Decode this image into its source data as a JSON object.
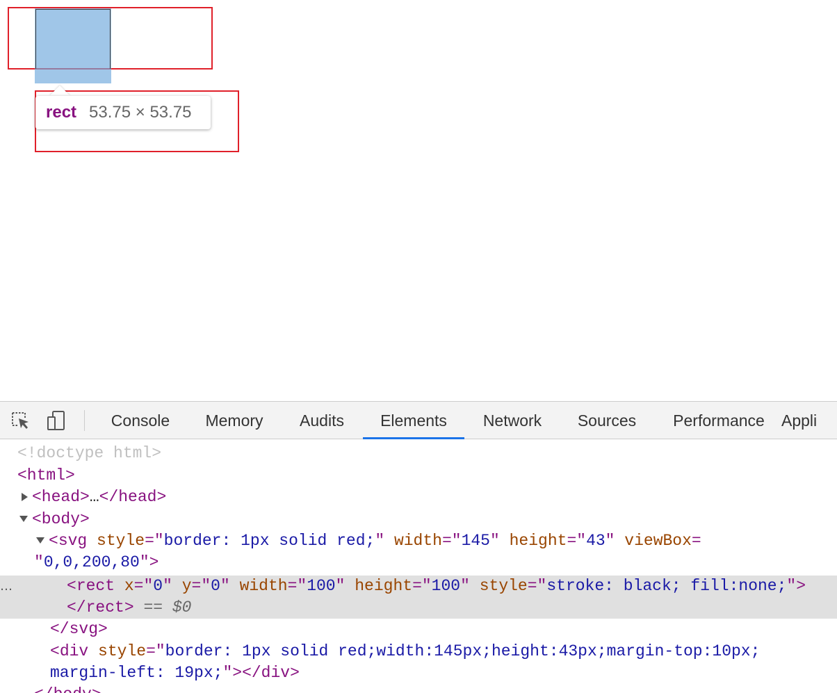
{
  "viewport": {
    "tooltip": {
      "tag": "rect",
      "size": "53.75 × 53.75"
    }
  },
  "devtools": {
    "tabs": [
      {
        "label": "Console",
        "active": false
      },
      {
        "label": "Memory",
        "active": false
      },
      {
        "label": "Audits",
        "active": false
      },
      {
        "label": "Elements",
        "active": true
      },
      {
        "label": "Network",
        "active": false
      },
      {
        "label": "Sources",
        "active": false
      },
      {
        "label": "Performance",
        "active": false
      },
      {
        "label": "Appli",
        "active": false
      }
    ],
    "icons": {
      "inspect": "inspect-element-icon",
      "device": "device-toolbar-icon"
    },
    "dom": {
      "doctype": "<!doctype html>",
      "html_open": "<html>",
      "head_open": "<head>",
      "head_ellipsis": "…",
      "head_close": "</head>",
      "body_open": "<body>",
      "svg_tag": "svg",
      "svg_attr_style": "style",
      "svg_val_style": "border: 1px solid red;",
      "svg_attr_width": "width",
      "svg_val_width": "145",
      "svg_attr_height": "height",
      "svg_val_height": "43",
      "svg_attr_viewbox": "viewBox",
      "svg_val_viewbox": "0,0,200,80",
      "rect_tag": "rect",
      "rect_attr_x": "x",
      "rect_val_x": "0",
      "rect_attr_y": "y",
      "rect_val_y": "0",
      "rect_attr_width": "width",
      "rect_val_width": "100",
      "rect_attr_height": "height",
      "rect_val_height": "100",
      "rect_attr_style": "style",
      "rect_val_style": "stroke: black; fill:none;",
      "rect_close": "</rect>",
      "selected_marker": "== $0",
      "gutter_ellipsis": "…",
      "svg_close": "</svg>",
      "div_tag": "div",
      "div_attr_style": "style",
      "div_val_style_1": "border: 1px solid red;width:145px;height:43px;margin-top:10px;",
      "div_val_style_2": "margin-left: 19px;",
      "div_close": "</div>",
      "body_close": "</body>"
    }
  },
  "colors": {
    "highlight_border": "#e0202a",
    "rect_highlight": "#6fa8dc",
    "active_tab_underline": "#1a73e8",
    "selected_row": "#e0e0e0"
  }
}
